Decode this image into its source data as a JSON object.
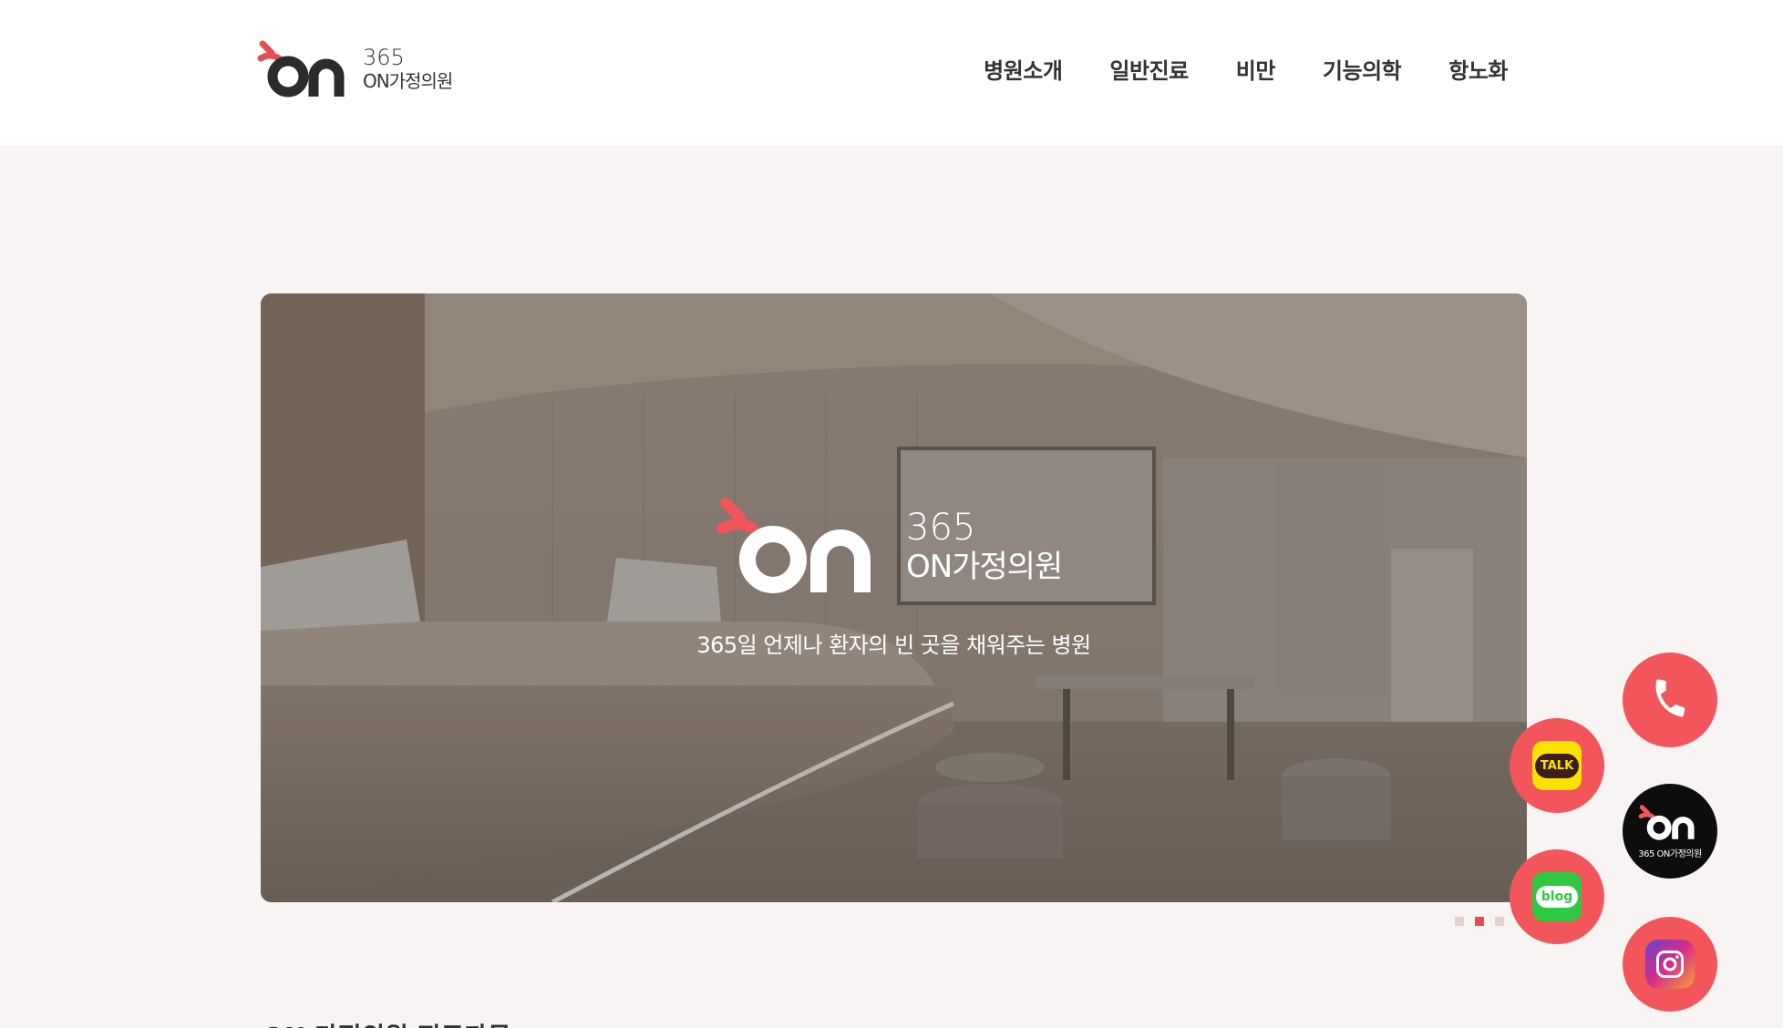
{
  "header": {
    "logo": {
      "number": "365",
      "name": "ON가정의원"
    },
    "nav": [
      "병원소개",
      "일반진료",
      "비만",
      "기능의학",
      "항노화"
    ]
  },
  "hero": {
    "brand_number": "365",
    "brand_name": "ON가정의원",
    "tagline": "365일 언제나 환자의 빈 곳을 채워주는 병원"
  },
  "pager": {
    "total": 3,
    "active_index": 1
  },
  "floating": {
    "talk_label": "TALK",
    "blog_label": "blog",
    "on_small": "365 ON가정의원"
  },
  "section": {
    "title": "ON 가정의원 진료과목"
  },
  "colors": {
    "accent": "#f2555a",
    "brand_red": "#e84a55",
    "kakao": "#ffe100",
    "naver": "#2fc840"
  }
}
